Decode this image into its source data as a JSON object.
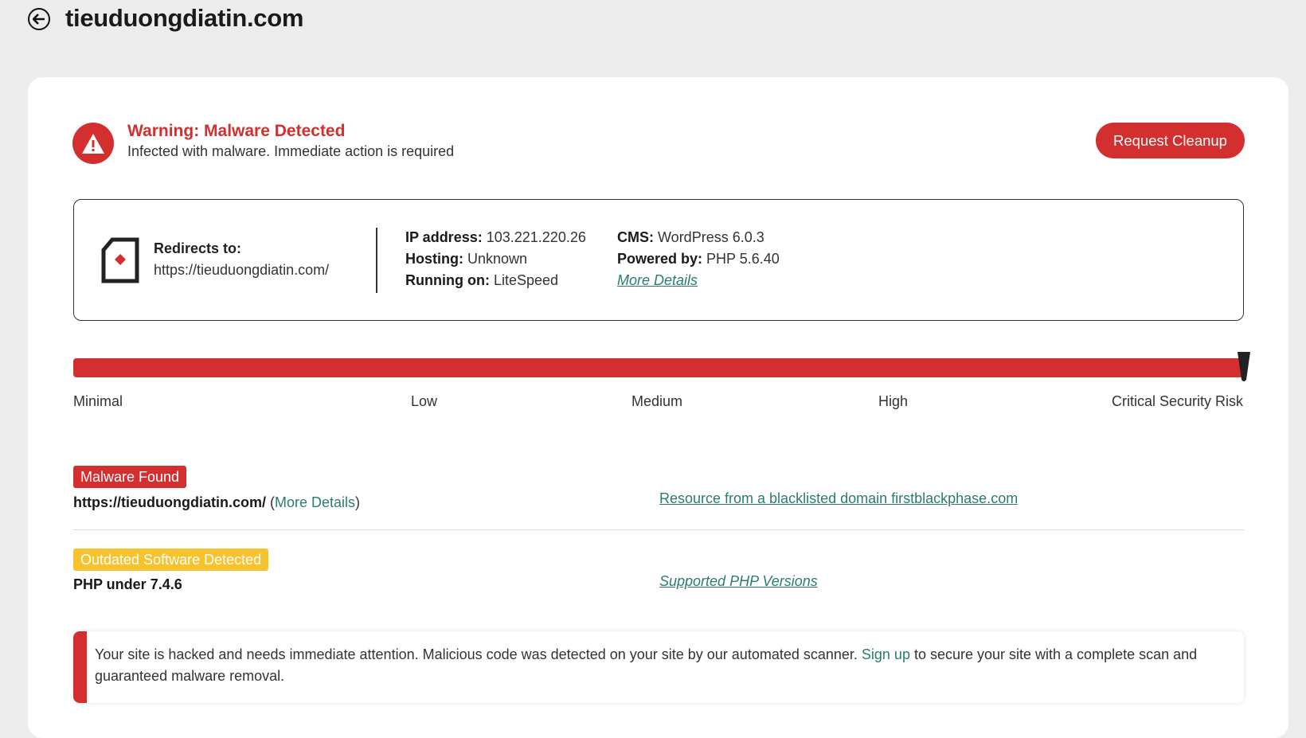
{
  "header": {
    "title": "tieuduongdiatin.com",
    "back_icon": "arrow-left-circle-icon"
  },
  "alert": {
    "title": "Warning: Malware Detected",
    "subtitle": "Infected with malware. Immediate action is required",
    "icon": "warning-triangle-icon",
    "action_label": "Request Cleanup"
  },
  "site_info": {
    "redirects_label": "Redirects to:",
    "redirects_url": "https://tieuduongdiatin.com/",
    "ip_label": "IP address:",
    "ip_value": "103.221.220.26",
    "hosting_label": "Hosting:",
    "hosting_value": "Unknown",
    "running_label": "Running on:",
    "running_value": "LiteSpeed",
    "cms_label": "CMS:",
    "cms_value": "WordPress 6.0.3",
    "powered_label": "Powered by:",
    "powered_value": "PHP 5.6.40",
    "more_details": "More Details"
  },
  "risk": {
    "level_fraction": 1.0,
    "labels": [
      "Minimal",
      "Low",
      "Medium",
      "High",
      "Critical Security Risk"
    ]
  },
  "findings": [
    {
      "badge": "Malware Found",
      "text": "https://tieuduongdiatin.com/",
      "more_open": " (",
      "more_link": "More Details",
      "more_close": ")",
      "detail_link": "Resource from a blacklisted domain firstblackphase.com"
    },
    {
      "badge": "Outdated Software Detected",
      "text": "PHP under 7.4.6",
      "detail_link": "Supported PHP Versions"
    }
  ],
  "notice": {
    "before": "Your site is hacked and needs immediate attention. Malicious code was detected on your site by our automated scanner. ",
    "link": "Sign up",
    "after": " to secure your site with a complete scan and guaranteed malware removal."
  },
  "colors": {
    "danger": "#d32f2f",
    "warning": "#f6c22d",
    "link": "#2a7d6e",
    "background": "#ececec"
  }
}
